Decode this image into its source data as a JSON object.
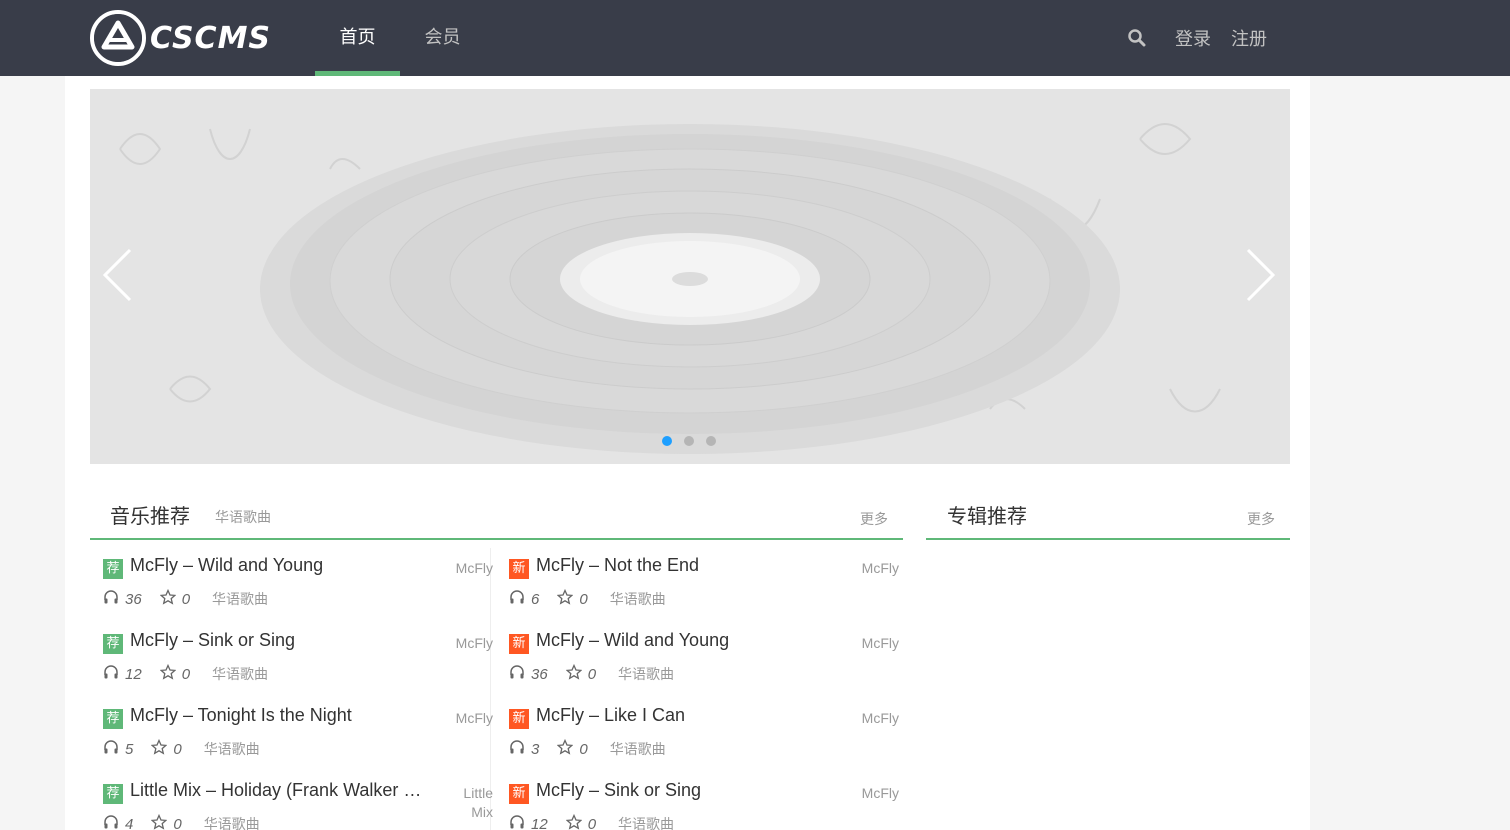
{
  "header": {
    "logo_text": "CSCMS",
    "nav": [
      {
        "label": "首页",
        "active": true
      },
      {
        "label": "会员",
        "active": false
      }
    ],
    "login_label": "登录",
    "register_label": "注册",
    "accent_color": "#5fb878",
    "bg_color": "#393d49"
  },
  "carousel": {
    "slides_count": 3,
    "active_index": 0,
    "prev_icon": "chevron-left-icon",
    "next_icon": "chevron-right-icon"
  },
  "music": {
    "title": "音乐推荐",
    "subtitle": "华语歌曲",
    "more_label": "更多",
    "left": [
      {
        "badge": "荐",
        "title": "McFly – Wild and Young",
        "artist": "McFly",
        "plays": "36",
        "favs": "0",
        "category": "华语歌曲"
      },
      {
        "badge": "荐",
        "title": "McFly – Sink or Sing",
        "artist": "McFly",
        "plays": "12",
        "favs": "0",
        "category": "华语歌曲"
      },
      {
        "badge": "荐",
        "title": "McFly – Tonight Is the Night",
        "artist": "McFly",
        "plays": "5",
        "favs": "0",
        "category": "华语歌曲"
      },
      {
        "badge": "荐",
        "title": "Little Mix – Holiday (Frank Walker Remix)",
        "artist": "Little Mix",
        "plays": "4",
        "favs": "0",
        "category": "华语歌曲"
      }
    ],
    "right": [
      {
        "badge": "新",
        "title": "McFly – Not the End",
        "artist": "McFly",
        "plays": "6",
        "favs": "0",
        "category": "华语歌曲"
      },
      {
        "badge": "新",
        "title": "McFly – Wild and Young",
        "artist": "McFly",
        "plays": "36",
        "favs": "0",
        "category": "华语歌曲"
      },
      {
        "badge": "新",
        "title": "McFly – Like I Can",
        "artist": "McFly",
        "plays": "3",
        "favs": "0",
        "category": "华语歌曲"
      },
      {
        "badge": "新",
        "title": "McFly – Sink or Sing",
        "artist": "McFly",
        "plays": "12",
        "favs": "0",
        "category": "华语歌曲"
      }
    ]
  },
  "albums": {
    "title": "专辑推荐",
    "more_label": "更多"
  }
}
